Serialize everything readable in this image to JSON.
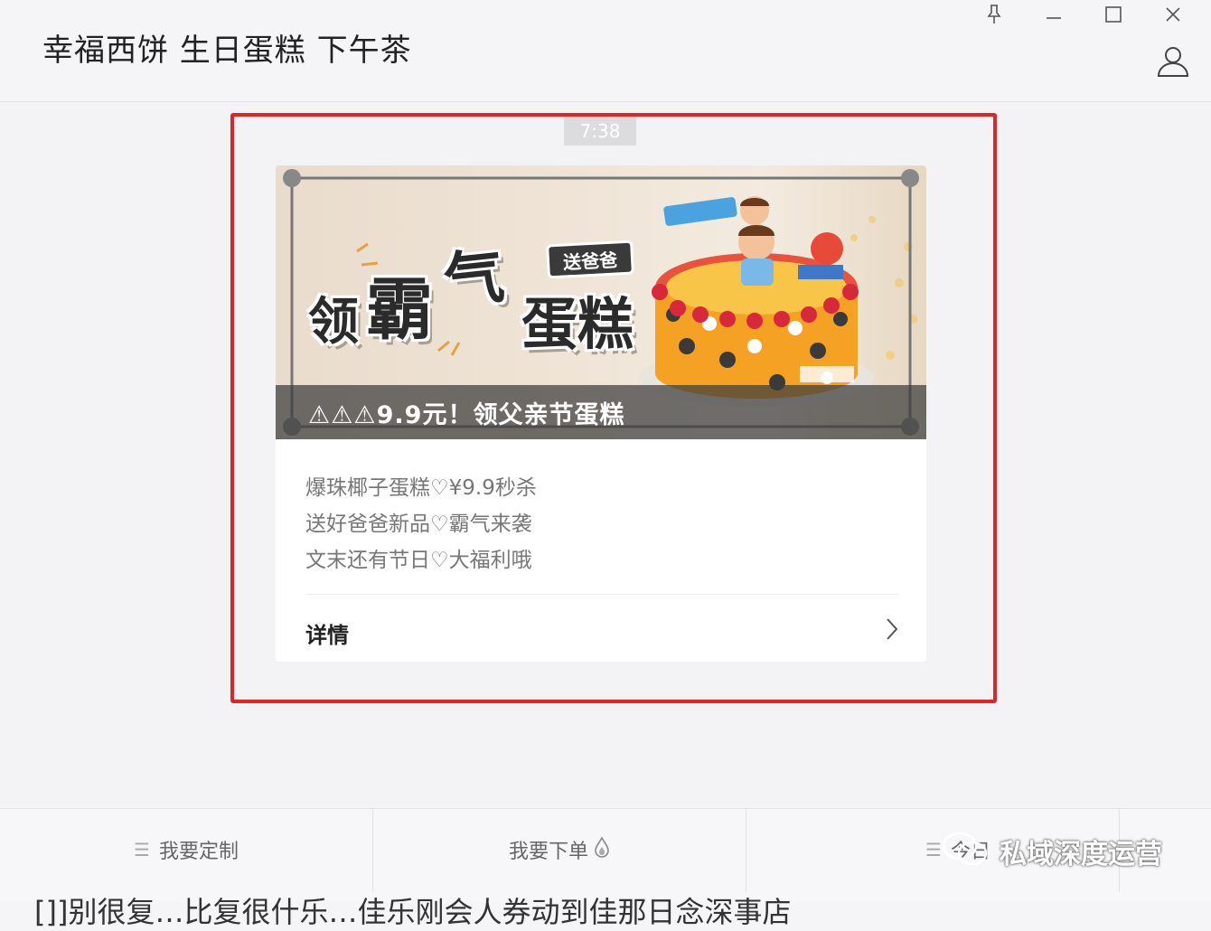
{
  "window": {
    "title": "幸福西饼 生日蛋糕 下午茶"
  },
  "chat": {
    "timestamp": "7:38",
    "card": {
      "banner_title_words": [
        "领",
        "霸",
        "气",
        "蛋糕"
      ],
      "banner_tag": "送爸爸",
      "banner_caption": "⚠⚠⚠9.9元！领父亲节蛋糕",
      "description_lines": [
        "爆珠椰子蛋糕♡¥9.9秒杀",
        "送好爸爸新品♡霸气来袭",
        "文末还有节日♡大福利哦"
      ],
      "details_label": "详情"
    }
  },
  "menu": {
    "items": [
      {
        "label": "我要定制",
        "icon": "list-icon"
      },
      {
        "label": "我要下单",
        "icon": "drop-icon"
      },
      {
        "label": "今日",
        "icon": "list-icon"
      }
    ]
  },
  "watermark": {
    "text": "私域深度运营"
  },
  "footer_cutoff": "[]]别很复…比复很什乐…佳乐刚会人券动到佳那日念深事店"
}
